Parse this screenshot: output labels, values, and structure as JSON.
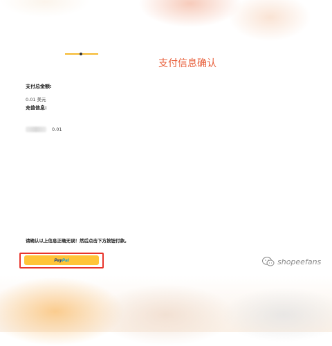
{
  "header": {
    "title": "支付信息确认"
  },
  "payment": {
    "total_label": "支付总金额:",
    "total_value": "0.01 美元",
    "recharge_label": "充值信息:",
    "recharge_amount": "0.01"
  },
  "notice": "请确认以上信息正确无误！然后点击下方按钮付款。",
  "paypal_button": {
    "text_part1": "Pay",
    "text_part2": "Pal"
  },
  "watermark": {
    "text": "shopeefans",
    "icon": "wechat-icon"
  },
  "colors": {
    "title": "#e8603c",
    "button": "#ffc439",
    "highlight": "#e8342b",
    "paypal_dark": "#003087",
    "paypal_light": "#009cde"
  }
}
